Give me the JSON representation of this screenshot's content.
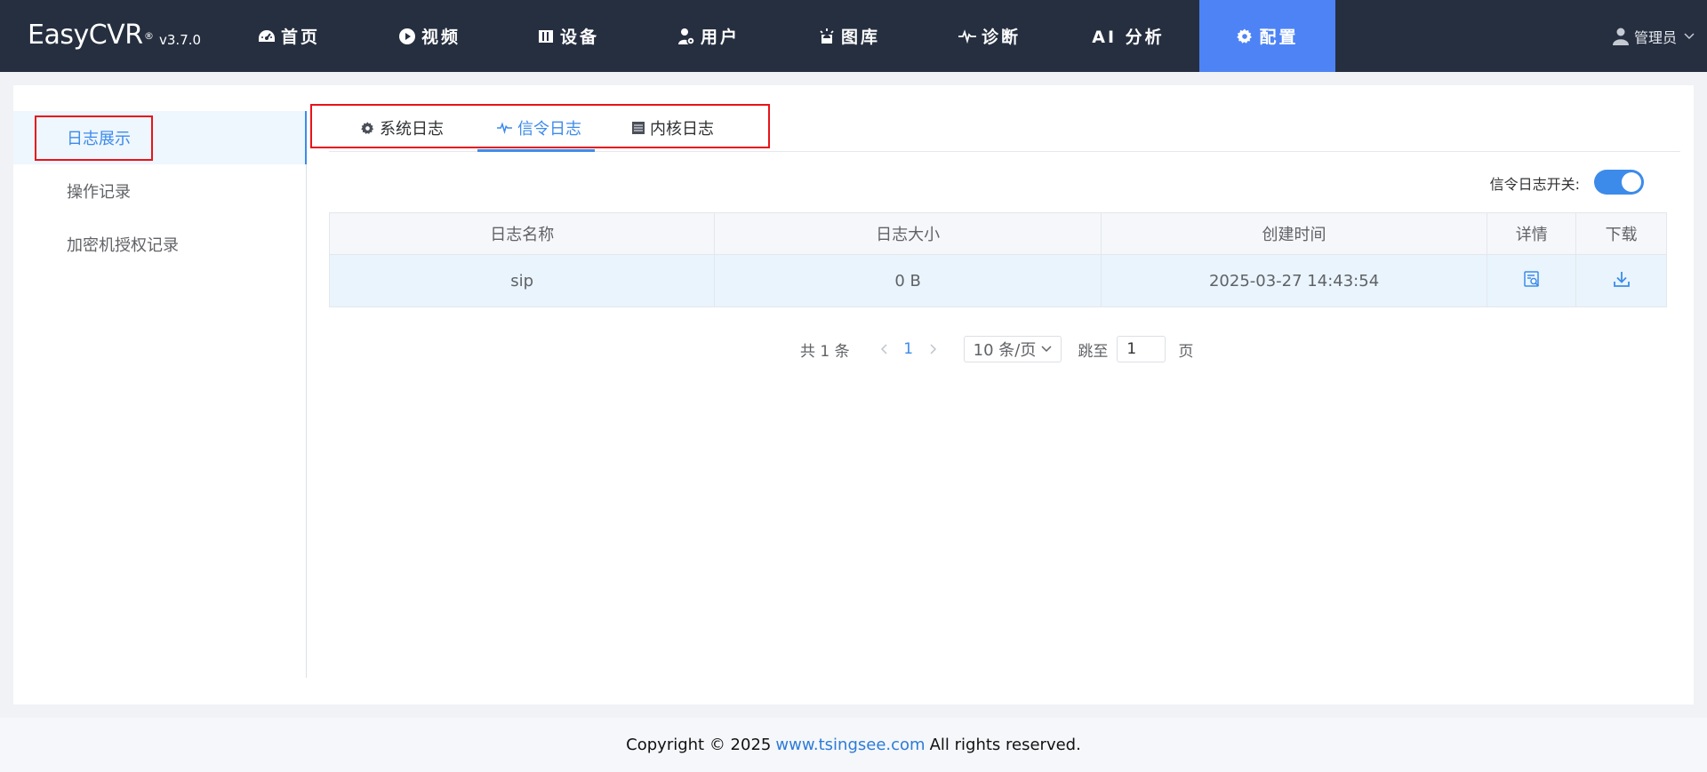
{
  "app": {
    "name": "EasyCVR",
    "registered": "®",
    "version": "v3.7.0"
  },
  "nav": {
    "items": [
      {
        "label": "首页",
        "icon": "dashboard-icon"
      },
      {
        "label": "视频",
        "icon": "play-circle-icon"
      },
      {
        "label": "设备",
        "icon": "device-icon"
      },
      {
        "label": "用户",
        "icon": "user-settings-icon"
      },
      {
        "label": "图库",
        "icon": "gallery-alarm-icon"
      },
      {
        "label": "诊断",
        "icon": "pulse-icon"
      },
      {
        "label": "AI 分析",
        "icon": ""
      },
      {
        "label": "配置",
        "icon": "gear-icon",
        "active": true
      }
    ],
    "user": "管理员"
  },
  "sidebar": {
    "items": [
      {
        "label": "日志展示",
        "active": true
      },
      {
        "label": "操作记录"
      },
      {
        "label": "加密机授权记录"
      }
    ]
  },
  "tabs": [
    {
      "label": "系统日志",
      "icon": "gear-icon"
    },
    {
      "label": "信令日志",
      "icon": "pulse-icon",
      "active": true
    },
    {
      "label": "内核日志",
      "icon": "list-icon"
    }
  ],
  "toggle": {
    "label": "信令日志开关:",
    "on": true
  },
  "table": {
    "columns": [
      "日志名称",
      "日志大小",
      "创建时间",
      "详情",
      "下载"
    ],
    "rows": [
      {
        "name": "sip",
        "size": "0 B",
        "created": "2025-03-27 14:43:54"
      }
    ]
  },
  "pagination": {
    "total": "共 1 条",
    "current_page": "1",
    "page_size": "10 条/页",
    "goto_label": "跳至",
    "goto_value": "1",
    "page_suffix": "页"
  },
  "footer": {
    "prefix": "Copyright © 2025",
    "link": "www.tsingsee.com",
    "suffix": "All rights reserved."
  },
  "colors": {
    "topbar": "#262f40",
    "nav_active": "#4d83f5",
    "accent": "#3c8bea",
    "highlight_box": "#e8141a"
  }
}
